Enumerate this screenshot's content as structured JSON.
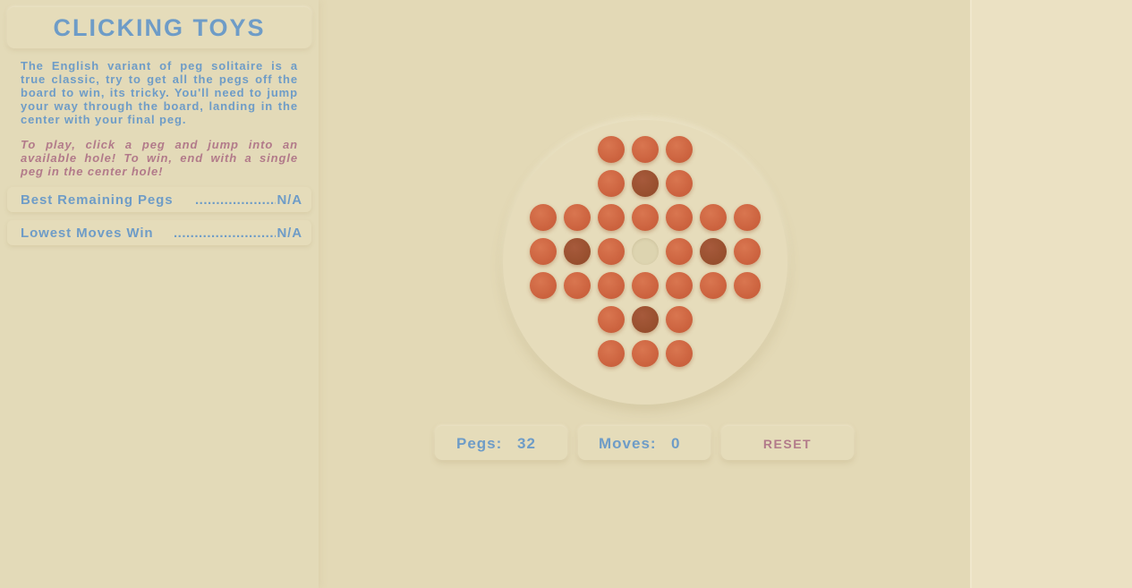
{
  "sidebar": {
    "title": "CLICKING TOYS",
    "description": "The English variant of peg solitaire is a true classic, try to get all the pegs off the board to win, its tricky. You'll need to jump your way through the board, landing in the center with your final peg.",
    "instructions": "To play, click a peg and jump into an available hole! To win, end with a single peg in the center hole!",
    "stats": {
      "best": {
        "label": "Best Remaining Pegs",
        "dots": "............................",
        "value": "N/A"
      },
      "lowest": {
        "label": "Lowest Moves Win",
        "dots": "..................................",
        "value": "N/A"
      }
    }
  },
  "controls": {
    "pegs_label": "Pegs:",
    "pegs_value": "32",
    "moves_label": "Moves:",
    "moves_value": "0",
    "reset_label": "RESET"
  },
  "board": {
    "layout": "english-cross-7x7",
    "rows": [
      [
        "",
        "",
        "peg",
        "peg",
        "peg",
        "",
        ""
      ],
      [
        "",
        "",
        "peg",
        "dark",
        "peg",
        "",
        ""
      ],
      [
        "peg",
        "peg",
        "peg",
        "peg",
        "peg",
        "peg",
        "peg"
      ],
      [
        "peg",
        "dark",
        "peg",
        "hole",
        "peg",
        "dark",
        "peg"
      ],
      [
        "peg",
        "peg",
        "peg",
        "peg",
        "peg",
        "peg",
        "peg"
      ],
      [
        "",
        "",
        "peg",
        "dark",
        "peg",
        "",
        ""
      ],
      [
        "",
        "",
        "peg",
        "peg",
        "peg",
        "",
        ""
      ]
    ]
  },
  "colors": {
    "background": "#e3d9b6",
    "accent_blue": "#6e9cc7",
    "accent_rose": "#b27a8a",
    "peg": "#cd6440",
    "peg_dark": "#99502f",
    "hole": "#ddd4b0"
  }
}
